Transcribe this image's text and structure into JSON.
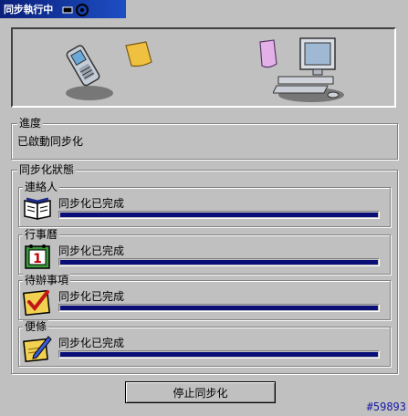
{
  "window": {
    "title": "同步執行中"
  },
  "progress": {
    "label": "進度",
    "value": "已啟動同步化"
  },
  "sync_status": {
    "label": "同步化狀態",
    "items": [
      {
        "name": "連絡人",
        "status": "同步化已完成",
        "progress": 1.0,
        "icon": "address-book-icon"
      },
      {
        "name": "行事曆",
        "status": "同步化已完成",
        "progress": 1.0,
        "icon": "calendar-icon"
      },
      {
        "name": "待辦事項",
        "status": "同步化已完成",
        "progress": 1.0,
        "icon": "task-check-icon"
      },
      {
        "name": "便條",
        "status": "同步化已完成",
        "progress": 1.0,
        "icon": "note-pencil-icon"
      }
    ]
  },
  "buttons": {
    "stop": "停止同步化"
  },
  "watermark": "#59893",
  "colors": {
    "titlebar": "#0a1f7a",
    "progress_fill": "#0a0f78",
    "watermark": "#1a1aa8"
  }
}
